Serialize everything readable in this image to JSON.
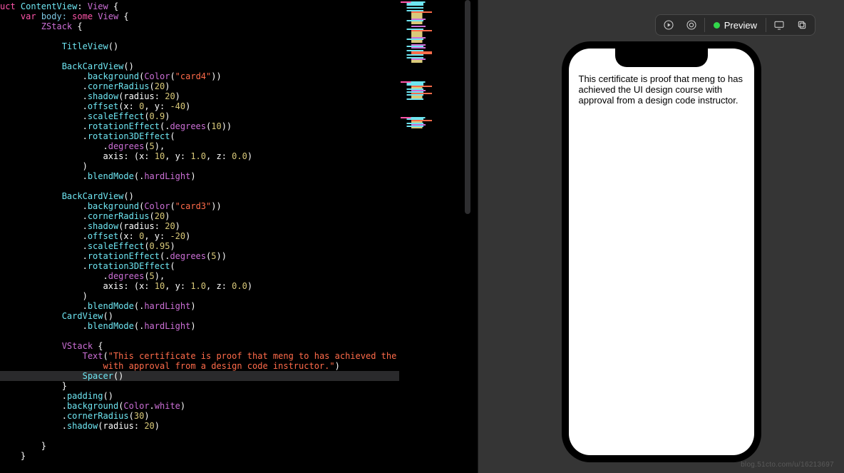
{
  "toolbar": {
    "preview_label": "Preview"
  },
  "phone": {
    "card_text": "This certificate is proof that meng to has achieved the UI design course with approval from a design code instructor."
  },
  "watermark": "blog.51cto.com/u/16213697",
  "code": {
    "l1": {
      "a": "uct ",
      "b": "ContentView",
      "c": ": ",
      "d": "View",
      "e": " {"
    },
    "l2": {
      "a": "var",
      "b": " body: ",
      "c": "some",
      "d": " View",
      "e": " {"
    },
    "l3": {
      "a": "ZStack",
      "b": " {"
    },
    "l4": "",
    "l5": {
      "a": "TitleView",
      "b": "()"
    },
    "l6": "",
    "l7": {
      "a": "BackCardView",
      "b": "()"
    },
    "l8": {
      "dot": ".",
      "a": "background",
      "b": "(",
      "c": "Color",
      "d": "(",
      "e": "\"card4\"",
      "f": "))"
    },
    "l9": {
      "dot": ".",
      "a": "cornerRadius",
      "b": "(",
      "c": "20",
      "d": ")"
    },
    "l10": {
      "dot": ".",
      "a": "shadow",
      "b": "(radius: ",
      "c": "20",
      "d": ")"
    },
    "l11": {
      "dot": ".",
      "a": "offset",
      "b": "(x: ",
      "c": "0",
      "d": ", y: ",
      "e": "-40",
      "f": ")"
    },
    "l12": {
      "dot": ".",
      "a": "scaleEffect",
      "b": "(",
      "c": "0.9",
      "d": ")"
    },
    "l13": {
      "dot": ".",
      "a": "rotationEffect",
      "b": "(.",
      "c": "degrees",
      "d": "(",
      "e": "10",
      "f": "))"
    },
    "l14": {
      "dot": ".",
      "a": "rotation3DEffect",
      "b": "("
    },
    "l15": {
      "dot": ".",
      "a": "degrees",
      "b": "(",
      "c": "5",
      "d": "),"
    },
    "l16": {
      "a": "axis: (x: ",
      "b": "10",
      "c": ", y: ",
      "d": "1.0",
      "e": ", z: ",
      "f": "0.0",
      "g": ")"
    },
    "l17": {
      "a": ")"
    },
    "l18": {
      "dot": ".",
      "a": "blendMode",
      "b": "(.",
      "c": "hardLight",
      "d": ")"
    },
    "l19": "",
    "l20": {
      "a": "BackCardView",
      "b": "()"
    },
    "l21": {
      "dot": ".",
      "a": "background",
      "b": "(",
      "c": "Color",
      "d": "(",
      "e": "\"card3\"",
      "f": "))"
    },
    "l22": {
      "dot": ".",
      "a": "cornerRadius",
      "b": "(",
      "c": "20",
      "d": ")"
    },
    "l23": {
      "dot": ".",
      "a": "shadow",
      "b": "(radius: ",
      "c": "20",
      "d": ")"
    },
    "l24": {
      "dot": ".",
      "a": "offset",
      "b": "(x: ",
      "c": "0",
      "d": ", y: ",
      "e": "-20",
      "f": ")"
    },
    "l25": {
      "dot": ".",
      "a": "scaleEffect",
      "b": "(",
      "c": "0.95",
      "d": ")"
    },
    "l26": {
      "dot": ".",
      "a": "rotationEffect",
      "b": "(.",
      "c": "degrees",
      "d": "(",
      "e": "5",
      "f": "))"
    },
    "l27": {
      "dot": ".",
      "a": "rotation3DEffect",
      "b": "("
    },
    "l28": {
      "dot": ".",
      "a": "degrees",
      "b": "(",
      "c": "5",
      "d": "),"
    },
    "l29": {
      "a": "axis: (x: ",
      "b": "10",
      "c": ", y: ",
      "d": "1.0",
      "e": ", z: ",
      "f": "0.0",
      "g": ")"
    },
    "l30": {
      "a": ")"
    },
    "l31": {
      "dot": ".",
      "a": "blendMode",
      "b": "(.",
      "c": "hardLight",
      "d": ")"
    },
    "l32": {
      "a": "CardView",
      "b": "()"
    },
    "l33": {
      "dot": ".",
      "a": "blendMode",
      "b": "(.",
      "c": "hardLight",
      "d": ")"
    },
    "l34": "",
    "l35": {
      "a": "VStack",
      "b": " {"
    },
    "l36": {
      "a": "Text",
      "b": "(",
      "c": "\"This certificate is proof that meng to has achieved the UI design course "
    },
    "l36b": {
      "a": "with approval from a design code instructor.\"",
      "b": ")"
    },
    "l37": {
      "a": "Spacer",
      "b": "()"
    },
    "l38": {
      "a": "}"
    },
    "l39": {
      "dot": ".",
      "a": "padding",
      "b": "()"
    },
    "l40": {
      "dot": ".",
      "a": "background",
      "b": "(",
      "c": "Color",
      "d": ".",
      "e": "white",
      "f": ")"
    },
    "l41": {
      "dot": ".",
      "a": "cornerRadius",
      "b": "(",
      "c": "30",
      "d": ")"
    },
    "l42": {
      "dot": ".",
      "a": "shadow",
      "b": "(radius: ",
      "c": "20",
      "d": ")"
    },
    "l43": "",
    "l44": {
      "a": "}"
    },
    "l45": {
      "a": "}"
    }
  }
}
